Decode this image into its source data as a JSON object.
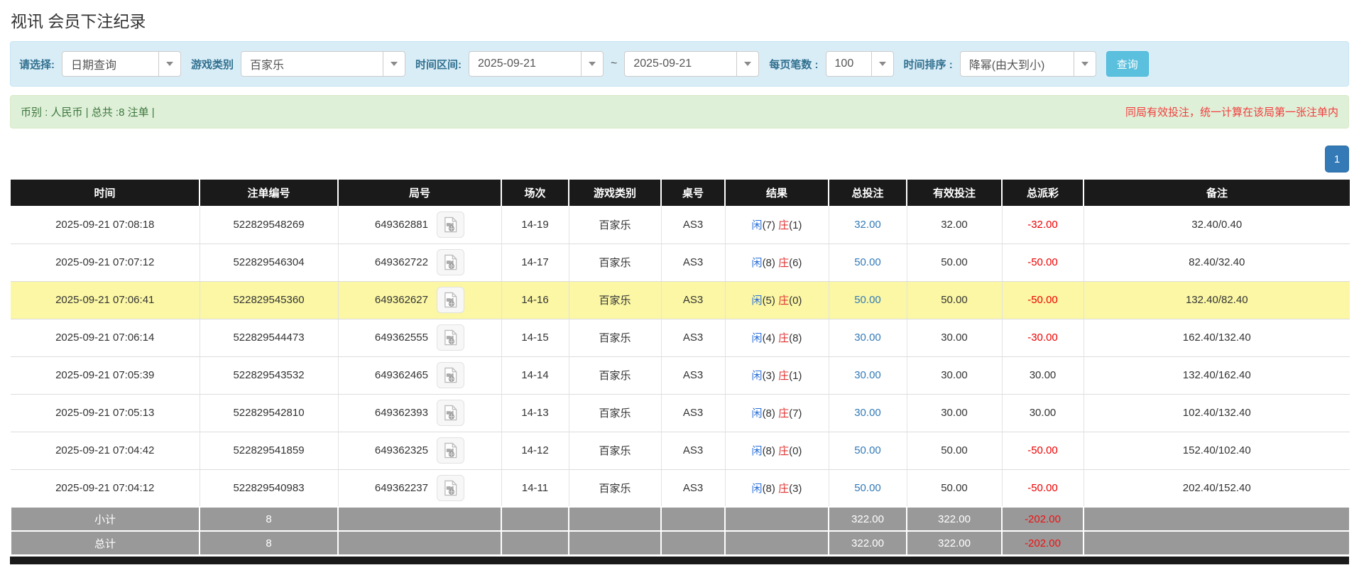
{
  "page": {
    "title": "视讯 会员下注纪录"
  },
  "filters": {
    "query_type": {
      "label": "请选择:",
      "value": "日期查询"
    },
    "game_category": {
      "label": "游戏类别",
      "value": "百家乐"
    },
    "date_range": {
      "label": "时间区间:",
      "from": "2025-09-21",
      "separator": "~",
      "to": "2025-09-21"
    },
    "page_size": {
      "label": "每页笔数 :",
      "value": "100"
    },
    "time_sort": {
      "label": "时间排序 :",
      "value": "降幂(由大到小)"
    },
    "search_button_label": "查询"
  },
  "summary_bar": {
    "left_text": "币别 : 人民币 | 总共 :8 注单 |",
    "right_note": "同局有效投注，统一计算在该局第一张注单内"
  },
  "pagination": {
    "current_page": "1"
  },
  "table": {
    "headers": [
      "时间",
      "注单编号",
      "局号",
      "场次",
      "游戏类别",
      "桌号",
      "结果",
      "总投注",
      "有效投注",
      "总派彩",
      "备注"
    ],
    "column_keys": [
      "time",
      "bet_id",
      "round_id",
      "session",
      "game",
      "table_no",
      "result",
      "total_bet",
      "valid_bet",
      "payout",
      "remark"
    ],
    "result_labels": {
      "player": "闲",
      "banker": "庄"
    },
    "video_icon": "video-record-icon",
    "rows": [
      {
        "time": "2025-09-21 07:08:18",
        "bet_id": "522829548269",
        "round_id": "649362881",
        "session": "14-19",
        "game": "百家乐",
        "table_no": "AS3",
        "player_count": "(7)",
        "banker_count": "(1)",
        "total_bet": "32.00",
        "valid_bet": "32.00",
        "payout": "-32.00",
        "remark": "32.40/0.40",
        "highlight": false
      },
      {
        "time": "2025-09-21 07:07:12",
        "bet_id": "522829546304",
        "round_id": "649362722",
        "session": "14-17",
        "game": "百家乐",
        "table_no": "AS3",
        "player_count": "(8)",
        "banker_count": "(6)",
        "total_bet": "50.00",
        "valid_bet": "50.00",
        "payout": "-50.00",
        "remark": "82.40/32.40",
        "highlight": false
      },
      {
        "time": "2025-09-21 07:06:41",
        "bet_id": "522829545360",
        "round_id": "649362627",
        "session": "14-16",
        "game": "百家乐",
        "table_no": "AS3",
        "player_count": "(5)",
        "banker_count": "(0)",
        "total_bet": "50.00",
        "valid_bet": "50.00",
        "payout": "-50.00",
        "remark": "132.40/82.40",
        "highlight": true
      },
      {
        "time": "2025-09-21 07:06:14",
        "bet_id": "522829544473",
        "round_id": "649362555",
        "session": "14-15",
        "game": "百家乐",
        "table_no": "AS3",
        "player_count": "(4)",
        "banker_count": "(8)",
        "total_bet": "30.00",
        "valid_bet": "30.00",
        "payout": "-30.00",
        "remark": "162.40/132.40",
        "highlight": false
      },
      {
        "time": "2025-09-21 07:05:39",
        "bet_id": "522829543532",
        "round_id": "649362465",
        "session": "14-14",
        "game": "百家乐",
        "table_no": "AS3",
        "player_count": "(3)",
        "banker_count": "(1)",
        "total_bet": "30.00",
        "valid_bet": "30.00",
        "payout": "30.00",
        "remark": "132.40/162.40",
        "highlight": false
      },
      {
        "time": "2025-09-21 07:05:13",
        "bet_id": "522829542810",
        "round_id": "649362393",
        "session": "14-13",
        "game": "百家乐",
        "table_no": "AS3",
        "player_count": "(8)",
        "banker_count": "(7)",
        "total_bet": "30.00",
        "valid_bet": "30.00",
        "payout": "30.00",
        "remark": "102.40/132.40",
        "highlight": false
      },
      {
        "time": "2025-09-21 07:04:42",
        "bet_id": "522829541859",
        "round_id": "649362325",
        "session": "14-12",
        "game": "百家乐",
        "table_no": "AS3",
        "player_count": "(8)",
        "banker_count": "(0)",
        "total_bet": "50.00",
        "valid_bet": "50.00",
        "payout": "-50.00",
        "remark": "152.40/102.40",
        "highlight": false
      },
      {
        "time": "2025-09-21 07:04:12",
        "bet_id": "522829540983",
        "round_id": "649362237",
        "session": "14-11",
        "game": "百家乐",
        "table_no": "AS3",
        "player_count": "(8)",
        "banker_count": "(3)",
        "total_bet": "50.00",
        "valid_bet": "50.00",
        "payout": "-50.00",
        "remark": "202.40/152.40",
        "highlight": false
      }
    ],
    "summary_rows": [
      {
        "label": "小计",
        "count": "8",
        "total_bet": "322.00",
        "valid_bet": "322.00",
        "payout": "-202.00"
      },
      {
        "label": "总计",
        "count": "8",
        "total_bet": "322.00",
        "valid_bet": "322.00",
        "payout": "-202.00"
      }
    ]
  },
  "colors": {
    "filter_panel_bg": "#d9edf7",
    "search_button_blue": "#5bc0de",
    "summary_bar_bg": "#dff0d8",
    "note_red": "#f23d3d",
    "pager_blue": "#337ab7",
    "header_black": "#1a1a1a",
    "highlight_yellow": "#fbf7a5",
    "link_blue": "#337ab7",
    "player_blue": "#2a6fd6",
    "banker_red": "#e03131",
    "negative_red": "#ee0000",
    "summary_row_gray": "#999999"
  }
}
